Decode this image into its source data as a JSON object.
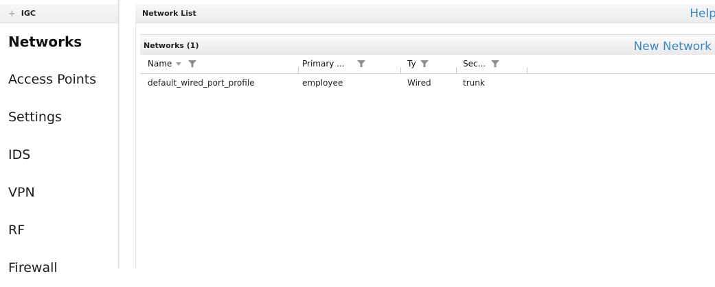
{
  "sidebar": {
    "header": "IGC",
    "items": [
      {
        "label": "Networks"
      },
      {
        "label": "Access Points"
      },
      {
        "label": "Settings"
      },
      {
        "label": "IDS"
      },
      {
        "label": "VPN"
      },
      {
        "label": "RF"
      },
      {
        "label": "Firewall"
      }
    ],
    "active_index": 0
  },
  "main": {
    "title": "Network List",
    "help_label": "Help",
    "section": {
      "title": "Networks (1)",
      "new_network_label": "New Network",
      "columns": [
        {
          "label": "Name",
          "sort_icon": "sort-desc-icon",
          "filter_icon": "filter-icon"
        },
        {
          "label": "Primary ...",
          "filter_icon": "filter-icon"
        },
        {
          "label": "Ty",
          "filter_icon": "filter-icon"
        },
        {
          "label": "Sec...",
          "filter_icon": "filter-icon"
        }
      ],
      "rows": [
        {
          "name": "default_wired_port_profile",
          "primary": "employee",
          "type": "Wired",
          "security": "trunk"
        }
      ]
    }
  },
  "colors": {
    "link": "#3c88bf",
    "header_gradient_top": "#f7f7f7",
    "header_gradient_bottom": "#ebebeb",
    "text": "#111111"
  }
}
